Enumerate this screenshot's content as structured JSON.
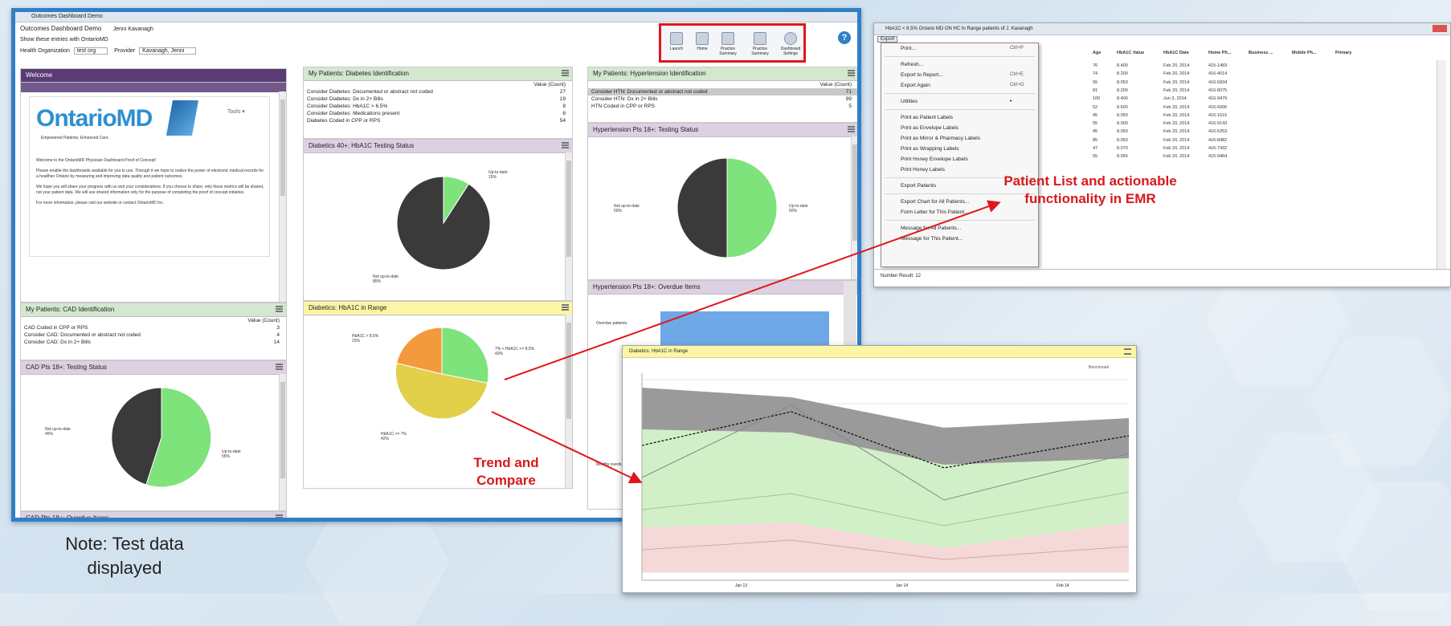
{
  "dashboard": {
    "window_title": "Outcomes Dashboard Demo",
    "app_title": "Outcomes Dashboard Demo",
    "user": "Jenni Kavanagh",
    "status_line": "Show these entries with OntarioMD",
    "health_org_label": "Health Organization",
    "health_org_value": "test org",
    "provider_label": "Provider",
    "provider_value": "Kavanagh, Jenni",
    "toolbar": [
      "Launch",
      "Home",
      "Practice Summary",
      "Practice Summary",
      "Dashboard Settings"
    ],
    "help_icon": "question-icon",
    "welcome": {
      "title": "Welcome",
      "logo_text": "OntarioMD",
      "logo_tagline": "Empowered Patients. Enhanced Care.",
      "tools_label": "Tools",
      "para1": "Welcome to the OntarioMD Physician Dashboard Proof of Concept!",
      "para2": "Please enable the dashboards available for you to use. Through it we hope to realize the power of electronic medical records for a healthier Ontario by measuring and improving data quality and patient outcomes.",
      "para3": "We hope you will share your progress with us and your considerations. If you choose to share, only those metrics will be shared, not your patient data. We will use shared information only for the purpose of completing the proof of concept initiative.",
      "para4": "For more information, please visit our website or contact OntarioMD Inc."
    },
    "cad_id": {
      "title": "My Patients: CAD Identification",
      "value_header": "Value (Count)",
      "rows": [
        {
          "label": "CAD Coded in CPP or RPS",
          "value": "3"
        },
        {
          "label": "Consider CAD: Documented or abstract not coded",
          "value": "4"
        },
        {
          "label": "Consider CAD: Dx in 2+ Bills",
          "value": "14"
        }
      ]
    },
    "cad_testing": {
      "title": "CAD Pts 18+: Testing Status",
      "label_not": "Not up-to-date",
      "label_not_pct": "45%",
      "label_up": "Up-to-date",
      "label_up_pct": "55%"
    },
    "cad_overdue": {
      "title": "CAD Pts 18+: Overdue Items"
    },
    "diab_id": {
      "title": "My Patients: Diabetes Identification",
      "value_header": "Value (Count)",
      "rows": [
        {
          "label": "Consider Diabetes: Documented or abstract not coded",
          "value": "27"
        },
        {
          "label": "Consider Diabetes: Dx in 2+ Bills",
          "value": "19"
        },
        {
          "label": "Consider Diabetes: HbA1C > 6.5%",
          "value": "8"
        },
        {
          "label": "Consider Diabetes: Medications present",
          "value": "8"
        },
        {
          "label": "Diabetes Coded in CPP or RPS",
          "value": "54"
        }
      ]
    },
    "diab_testing": {
      "title": "Diabetics 40+: HbA1C Testing Status",
      "label_up": "Up-to-date",
      "label_up_pct": "15%",
      "label_not": "Not up-to-date",
      "label_not_pct": "85%"
    },
    "diab_range": {
      "title": "Diabetics: HbA1C in Range",
      "label_a": "HbA1C > 8.5%",
      "label_a_pct": "15%",
      "label_b": "HbA1C <= 7%",
      "label_b_pct": "42%",
      "label_c": "7% < HbA1C <= 8.5%",
      "label_c_pct": "43%"
    },
    "htn_id": {
      "title": "My Patients: Hypertension Identification",
      "value_header": "Value (Count)",
      "rows": [
        {
          "label": "Consider HTN: Documented or abstract not coded",
          "value": "71"
        },
        {
          "label": "Consider HTN: Dx in 2+ Bills",
          "value": "99"
        },
        {
          "label": "HTN Coded in CPP or RPS",
          "value": "5"
        }
      ]
    },
    "htn_testing": {
      "title": "Hypertension Pts 18+: Testing Status",
      "label_not": "Not up-to-date",
      "label_not_pct": "50%",
      "label_up": "Up-to-date",
      "label_up_pct": "50%"
    },
    "htn_overdue": {
      "title": "Hypertension Pts 18+: Overdue Items",
      "side_label": "Overdue patients",
      "bottom_label": "Months overdue"
    }
  },
  "emr": {
    "window_title": "HbA1C < 8.5% Ontario MD ON HC In Range patients of J. Kavanagh",
    "menu": "Export",
    "context_menu": [
      {
        "label": "Print...",
        "shortcut": "Ctrl+P"
      },
      {
        "sep": true
      },
      {
        "label": "Refresh...",
        "shortcut": ""
      },
      {
        "label": "Export to Report...",
        "shortcut": "Ctrl+E"
      },
      {
        "label": "Export Again",
        "shortcut": "Ctrl+G"
      },
      {
        "sep": true
      },
      {
        "label": "Utilities",
        "shortcut": "▸"
      },
      {
        "sep": true
      },
      {
        "label": "Print as Patient Labels",
        "shortcut": ""
      },
      {
        "label": "Print as Envelope Labels",
        "shortcut": ""
      },
      {
        "label": "Print as Mirror & Pharmacy Labels",
        "shortcut": ""
      },
      {
        "label": "Print as Wrapping Labels",
        "shortcut": ""
      },
      {
        "label": "Print Honey Envelope Labels",
        "shortcut": ""
      },
      {
        "label": "Print Honey Labels",
        "shortcut": ""
      },
      {
        "sep": true
      },
      {
        "label": "Export Patients",
        "shortcut": ""
      },
      {
        "sep": true
      },
      {
        "label": "Export Chart for All Patients...",
        "shortcut": ""
      },
      {
        "label": "Form Letter for This Patient...",
        "shortcut": ""
      },
      {
        "sep": true
      },
      {
        "label": "Message for All Patients...",
        "shortcut": ""
      },
      {
        "label": "Message for This Patient...",
        "shortcut": ""
      }
    ],
    "columns": [
      "Age",
      "HbA1C Value",
      "HbA1C Date",
      "Home Ph...",
      "Business ...",
      "Mobile Ph...",
      "Primary"
    ],
    "rows": [
      [
        "76",
        "8.400",
        "Feb 20, 2014",
        "415-1483"
      ],
      [
        "74",
        "8.200",
        "Feb 20, 2014",
        "416-4014"
      ],
      [
        "55",
        "8.050",
        "Feb 20, 2014",
        "416-5834"
      ],
      [
        "81",
        "8.200",
        "Feb 20, 2014",
        "416-8075"
      ],
      [
        "100",
        "8.400",
        "Jun 3, 2014",
        "416-9479"
      ],
      [
        "52",
        "8.600",
        "Feb 20, 2014",
        "416-6006"
      ],
      [
        "45",
        "8.050",
        "Feb 20, 2014",
        "416-1615"
      ],
      [
        "55",
        "8.000",
        "Feb 20, 2014",
        "416-9143"
      ],
      [
        "45",
        "8.050",
        "Feb 20, 2014",
        "416-5253"
      ],
      [
        "85",
        "8.050",
        "Feb 20, 2014",
        "416-8482"
      ],
      [
        "47",
        "8.070",
        "Feb 20, 2014",
        "416-7432"
      ],
      [
        "55",
        "8.056",
        "Feb 20, 2014",
        "415-9464"
      ]
    ],
    "footer": "Number Result: 12"
  },
  "trend": {
    "title": "Diabetics: HbA1C in Range",
    "legend": "Benchmark",
    "x_ticks": [
      "Jan 13",
      "Jan 14",
      "Feb 14"
    ]
  },
  "annotations": {
    "patient_list": "Patient List and actionable functionality in EMR",
    "trend": "Trend and Compare",
    "note": "Note: Test data displayed"
  },
  "colors": {
    "accent": "#2f7fc8",
    "highlight": "#e1161c",
    "pie_green": "#7de37a",
    "pie_dark": "#3a3a3a",
    "pie_yellow": "#e2cf4a",
    "pie_orange": "#f39a3c"
  }
}
